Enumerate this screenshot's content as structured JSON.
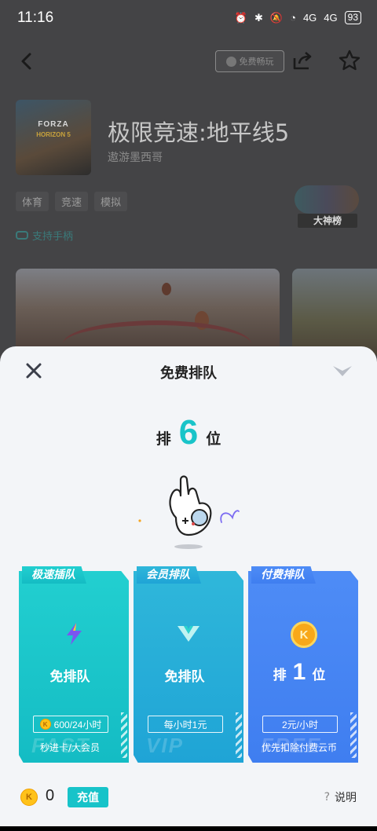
{
  "status": {
    "time": "11:16",
    "battery": "93",
    "signal1": "4G",
    "signal2": "4G"
  },
  "nav": {
    "free_badge": "免费畅玩"
  },
  "game": {
    "title": "极限竞速:地平线5",
    "subtitle": "遨游墨西哥",
    "cover_logo": "FORZA",
    "cover_logo2": "HORIZON 5",
    "tags": [
      "体育",
      "竞速",
      "模拟"
    ],
    "gamepad_label": "支持手柄",
    "rank_badge": "大神榜"
  },
  "sheet": {
    "title": "免费排队",
    "queue_prefix": "排",
    "queue_position": "6",
    "queue_suffix": "位"
  },
  "cards": [
    {
      "tab": "极速插队",
      "main": "免排队",
      "pill": "600/24小时",
      "foot": "秒进卡/大会员",
      "watermark": "FAST",
      "icon": "lightning-icon"
    },
    {
      "tab": "会员排队",
      "main": "免排队",
      "pill": "每小时1元",
      "foot": "",
      "watermark": "VIP",
      "icon": "vip-chevron-icon"
    },
    {
      "tab": "付费排队",
      "main_prefix": "排",
      "main_number": "1",
      "main_suffix": "位",
      "pill": "2元/小时",
      "foot": "优先扣除付费云币",
      "watermark": "FREE",
      "icon": "coin-icon"
    }
  ],
  "footer": {
    "coin_glyph": "K",
    "balance": "0",
    "recharge": "充值",
    "help_icon": "?",
    "help": "说明"
  },
  "colors": {
    "accent": "#19c4c9",
    "card1": "#1cc6cb",
    "card2": "#27aedb",
    "card3": "#4786f3"
  }
}
